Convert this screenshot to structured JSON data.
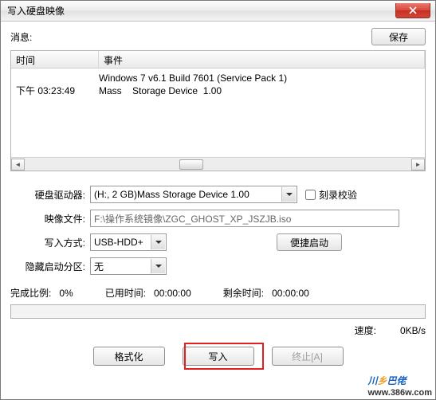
{
  "window": {
    "title": "写入硬盘映像"
  },
  "header": {
    "msg_label": "消息:",
    "save_btn": "保存"
  },
  "log": {
    "col_time": "时间",
    "col_event": "事件",
    "lines": [
      {
        "time": "",
        "event": "Windows 7 v6.1 Build 7601 (Service Pack 1)"
      },
      {
        "time": "下午 03:23:49",
        "event": "Mass    Storage Device  1.00"
      }
    ]
  },
  "form": {
    "drive_label": "硬盘驱动器:",
    "drive_value": "(H:, 2 GB)Mass   Storage Device  1.00",
    "verify_label": "刻录校验",
    "image_label": "映像文件:",
    "image_value": "F:\\操作系统镜像\\ZGC_GHOST_XP_JSZJB.iso",
    "write_label": "写入方式:",
    "write_value": "USB-HDD+",
    "quick_btn": "便捷启动",
    "hide_label": "隐藏启动分区:",
    "hide_value": "无"
  },
  "progress": {
    "done_label": "完成比例:",
    "done_value": "0%",
    "elapsed_label": "已用时间:",
    "elapsed_value": "00:00:00",
    "remain_label": "剩余时间:",
    "remain_value": "00:00:00",
    "speed_label": "速度:",
    "speed_value": "0KB/s"
  },
  "buttons": {
    "format": "格式化",
    "write": "写入",
    "abort": "终止[A]"
  },
  "watermark": {
    "part1": "川",
    "part2": "乡",
    "part3": "巴佬",
    "url": "www.386w.com"
  }
}
